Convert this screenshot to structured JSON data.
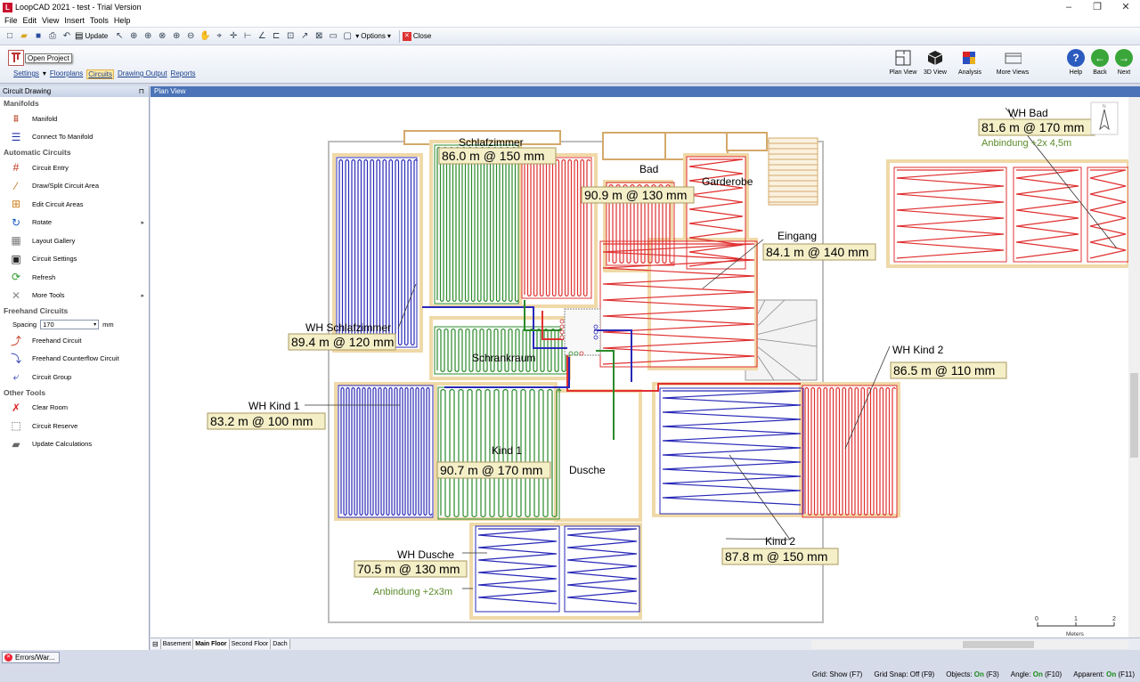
{
  "window": {
    "title": "LoopCAD 2021 - test - Trial Version",
    "app_icon": "L",
    "min": "–",
    "max": "❐",
    "close": "✕"
  },
  "menu": [
    "File",
    "Edit",
    "View",
    "Insert",
    "Tools",
    "Help"
  ],
  "toolbar": {
    "update": "Update",
    "options": "Options",
    "close": "Close"
  },
  "ribbon": {
    "tooltip": "Open Project",
    "links": [
      "Settings",
      "Floorplans",
      "Circuits",
      "Drawing Output",
      "Reports"
    ],
    "active": "Circuits",
    "buttons": {
      "plan_view": "Plan View",
      "view3d": "3D View",
      "analysis": "Analysis",
      "more_views": "More Views",
      "help": "Help",
      "back": "Back",
      "next": "Next"
    }
  },
  "left_panel": {
    "title": "Circuit Drawing",
    "pin": "ᵖ",
    "sections": {
      "manifolds": "Manifolds",
      "automatic": "Automatic Circuits",
      "freehand": "Freehand Circuits",
      "other": "Other Tools"
    },
    "items": {
      "manifold": "Manifold",
      "connect": "Connect To Manifold",
      "entry": "Circuit Entry",
      "draw_split": "Draw/Split Circuit Area",
      "edit_areas": "Edit Circuit Areas",
      "rotate": "Rotate",
      "gallery": "Layout Gallery",
      "settings": "Circuit Settings",
      "refresh": "Refresh",
      "more_tools": "More Tools",
      "freehand": "Freehand Circuit",
      "counterflow": "Freehand Counterflow Circuit",
      "group": "Circuit Group",
      "clear_room": "Clear Room",
      "reserve": "Circuit Reserve",
      "update_calc": "Update Calculations"
    },
    "spacing_label": "Spacing",
    "spacing_value": "170",
    "spacing_unit": "mm"
  },
  "plan_view": {
    "title": "Plan View",
    "rooms": {
      "schlafzimmer": "Schlafzimmer",
      "bad": "Bad",
      "garderobe": "Garderobe",
      "eingang": "Eingang",
      "schrankraum": "Schrankraum",
      "kind1": "Kind 1",
      "dusche": "Dusche",
      "kind2": "Kind 2",
      "wh_bad": "WH Bad",
      "wh_schlaf": "WH Schlafzimmer",
      "wh_kind1": "WH Kind 1",
      "wh_kind2": "WH Kind 2",
      "wh_dusche": "WH Dusche"
    },
    "circuits": {
      "schlaf": "86.0 m @ 150 mm",
      "bad": "90.9 m @ 130 mm",
      "eingang": "84.1 m @ 140 mm",
      "wh_bad": "81.6 m @ 170 mm",
      "wh_schlaf": "89.4 m @ 120 mm",
      "wh_kind1": "83.2 m @ 100 mm",
      "kind1": "90.7 m @ 170 mm",
      "wh_kind2": "86.5 m @ 110 mm",
      "kind2": "87.8 m @ 150 mm",
      "wh_dusche": "70.5 m @ 130 mm"
    },
    "notes": {
      "wh_bad": "Anbindung +2x 4,5m",
      "wh_dusche": "Anbindung +2x3m"
    },
    "scale": {
      "t0": "0",
      "t1": "1",
      "t2": "2",
      "unit": "Meters"
    },
    "north": "N"
  },
  "floor_tabs": [
    "Basement",
    "Main Floor",
    "Second Floor",
    "Dach"
  ],
  "active_floor": "Main Floor",
  "errors_button": "Errors/War...",
  "status": {
    "grid": "Grid: Show (F7)",
    "snap": "Grid Snap: Off (F9)",
    "objects_l": "Objects:",
    "objects_v": "On",
    "objects_k": "(F3)",
    "angle_l": "Angle:",
    "angle_v": "On",
    "angle_k": "(F10)",
    "apparent_l": "Apparent:",
    "apparent_v": "On",
    "apparent_k": "(F11)"
  },
  "colors": {
    "blue": "#2929b8",
    "green": "#2a8a2a",
    "red": "#e03030",
    "label_bg": "#f5efc8",
    "wall": "#f0d9a8"
  }
}
